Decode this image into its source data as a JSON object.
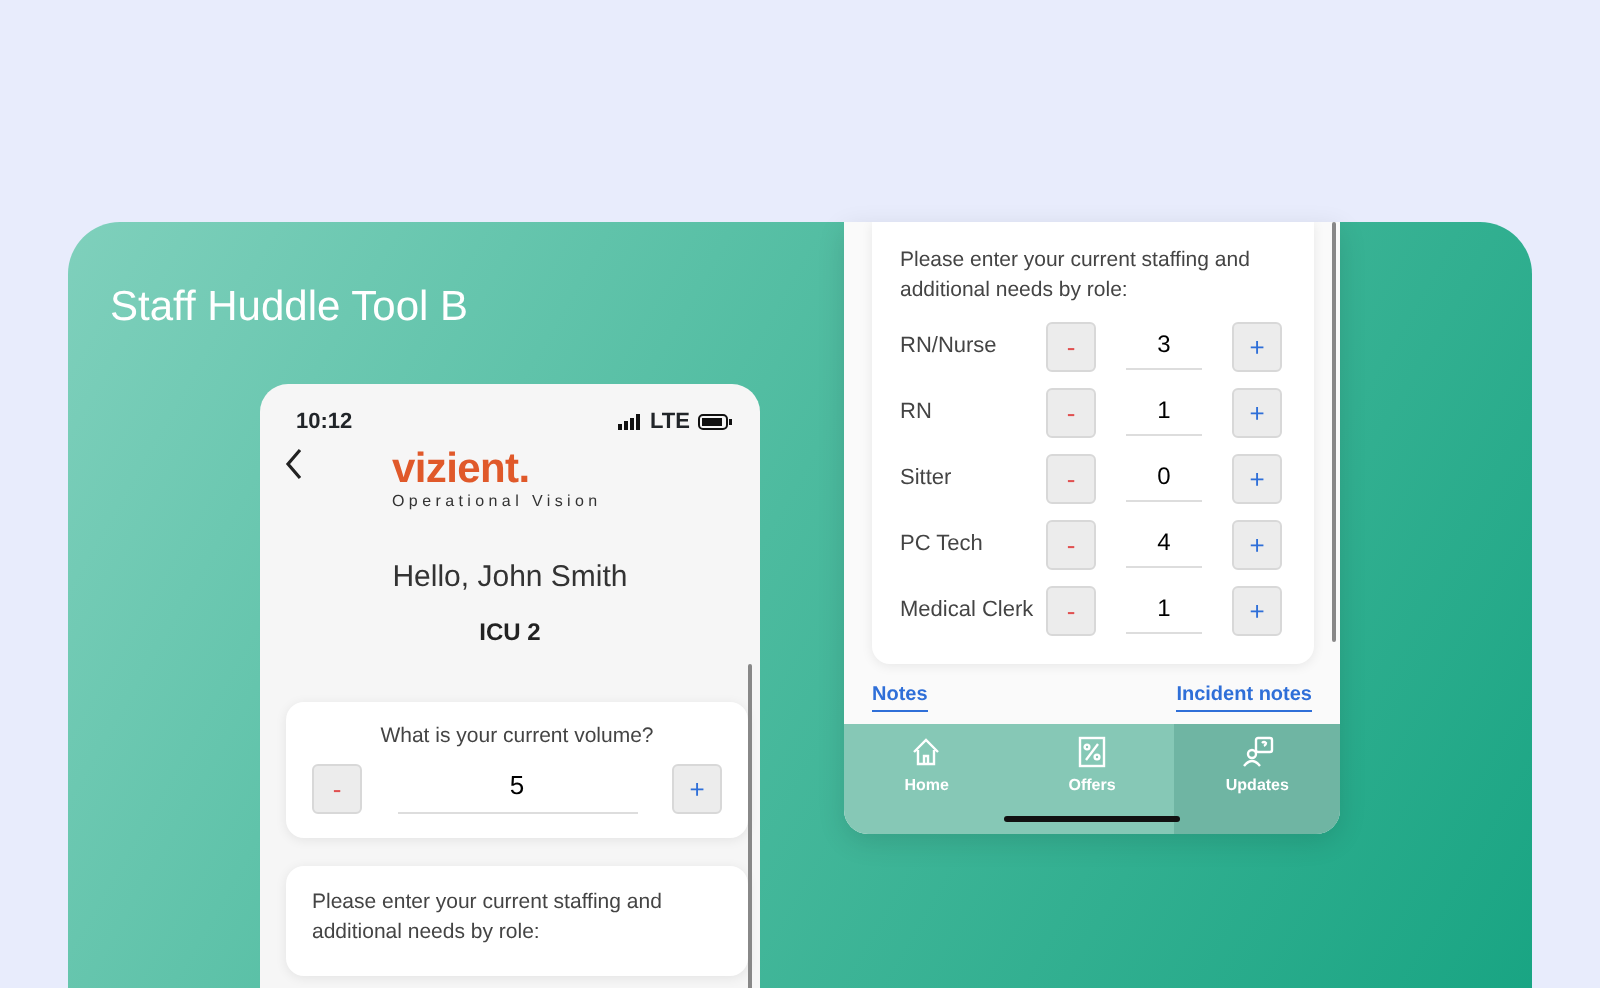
{
  "title": "Staff Huddle Tool B",
  "phone_1": {
    "status_bar": {
      "time": "10:12",
      "network": "LTE"
    },
    "logo": {
      "brand": "vizient.",
      "tagline": "Operational Vision"
    },
    "greeting": "Hello, John Smith",
    "unit": "ICU 2",
    "volume": {
      "question": "What is your current volume?",
      "minus": "-",
      "value": "5",
      "plus": "+"
    },
    "staffing_prompt": "Please enter your current staffing and additional needs by role:"
  },
  "phone_2": {
    "staffing_prompt": "Please enter your current staffing and additional needs by role:",
    "roles": [
      {
        "name": "RN/Nurse",
        "minus": "-",
        "value": "3",
        "plus": "+"
      },
      {
        "name": "RN",
        "minus": "-",
        "value": "1",
        "plus": "+"
      },
      {
        "name": "Sitter",
        "minus": "-",
        "value": "0",
        "plus": "+"
      },
      {
        "name": "PC Tech",
        "minus": "-",
        "value": "4",
        "plus": "+"
      },
      {
        "name": "Medical Clerk",
        "minus": "-",
        "value": "1",
        "plus": "+"
      }
    ],
    "links": [
      "Notes",
      "Incident notes"
    ],
    "tabs": [
      {
        "label": "Home",
        "kind": "home",
        "selected": false
      },
      {
        "label": "Offers",
        "kind": "offers",
        "selected": false
      },
      {
        "label": "Updates",
        "kind": "updates",
        "selected": true
      }
    ]
  }
}
